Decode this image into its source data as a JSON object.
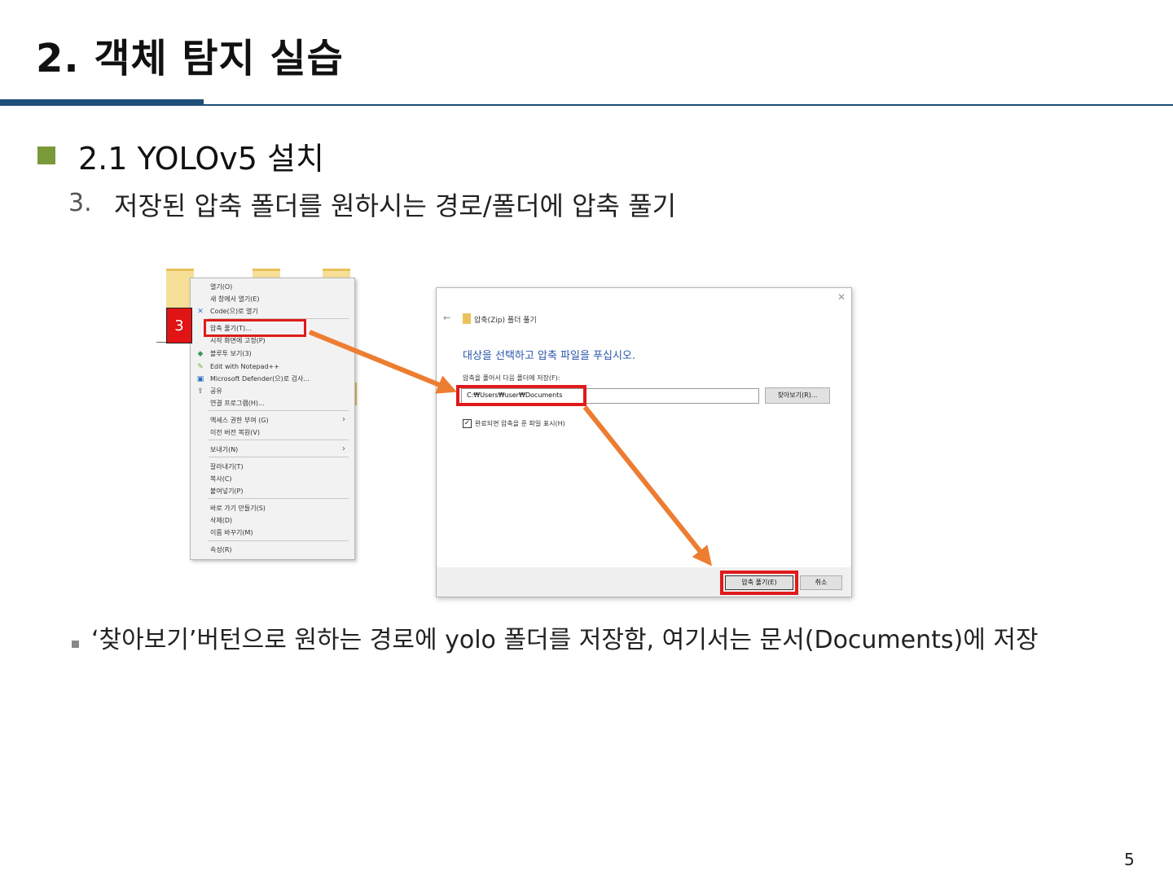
{
  "slide": {
    "title": "2. 객체 탐지 실습",
    "section": "2.1 YOLOv5 설치",
    "step_number": "3.",
    "step_text": "저장된 압축 폴더를 원하시는 경로/폴더에 압축 풀기",
    "note": "‘찾아보기’버턴으로 원하는 경로에 yolo 폴더를 저장함, 여기서는 문서(Documents)에 저장",
    "page_number": "5"
  },
  "colors": {
    "title_rule": "#1f4e79",
    "section_bullet": "#7a9a3a",
    "highlight_red": "#e01a1a",
    "arrow_orange": "#ed7d31",
    "dialog_heading": "#2a56a8"
  },
  "context_menu": {
    "step_badge": "3",
    "items": [
      {
        "label": "열기(O)",
        "icon": ""
      },
      {
        "label": "새 창에서 열기(E)",
        "icon": ""
      },
      {
        "label": "Code(으)로 열기",
        "icon": "vscode-icon"
      },
      {
        "label": "압축 풀기(T)...",
        "icon": ""
      },
      {
        "label": "시작 화면에 고정(P)",
        "icon": ""
      },
      {
        "label": "블루투 보기(3)",
        "icon": "diamond-icon"
      },
      {
        "label": "Edit with Notepad++",
        "icon": "notepad-icon"
      },
      {
        "label": "Microsoft Defender(으)로 검사...",
        "icon": "shield-icon"
      },
      {
        "label": "공유",
        "icon": "share-icon"
      },
      {
        "label": "연결 프로그램(H)...",
        "icon": ""
      },
      {
        "label": "액세스 권한 부여 (G)",
        "icon": "",
        "submenu": true
      },
      {
        "label": "이전 버전 복원(V)",
        "icon": ""
      },
      {
        "label": "보내기(N)",
        "icon": "",
        "submenu": true
      },
      {
        "label": "잘라내기(T)",
        "icon": ""
      },
      {
        "label": "복사(C)",
        "icon": ""
      },
      {
        "label": "붙여넣기(P)",
        "icon": ""
      },
      {
        "label": "바로 가기 만들기(S)",
        "icon": ""
      },
      {
        "label": "삭제(D)",
        "icon": ""
      },
      {
        "label": "이름 바꾸기(M)",
        "icon": ""
      },
      {
        "label": "속성(R)",
        "icon": ""
      }
    ]
  },
  "extract_dialog": {
    "window_title": "압축(Zip) 폴더 풀기",
    "heading": "대상을 선택하고 압축 파일을 푸십시오.",
    "path_label": "압축을 풀어서 다음 폴더에 저장(F):",
    "path_value": "C:₩Users₩user₩Documents",
    "browse_label": "찾아보기(R)...",
    "checkbox_label": "완료되면 압축을 푼 파일 표시(H)",
    "checkbox_checked": true,
    "extract_label": "압축 풀기(E)",
    "cancel_label": "취소"
  }
}
